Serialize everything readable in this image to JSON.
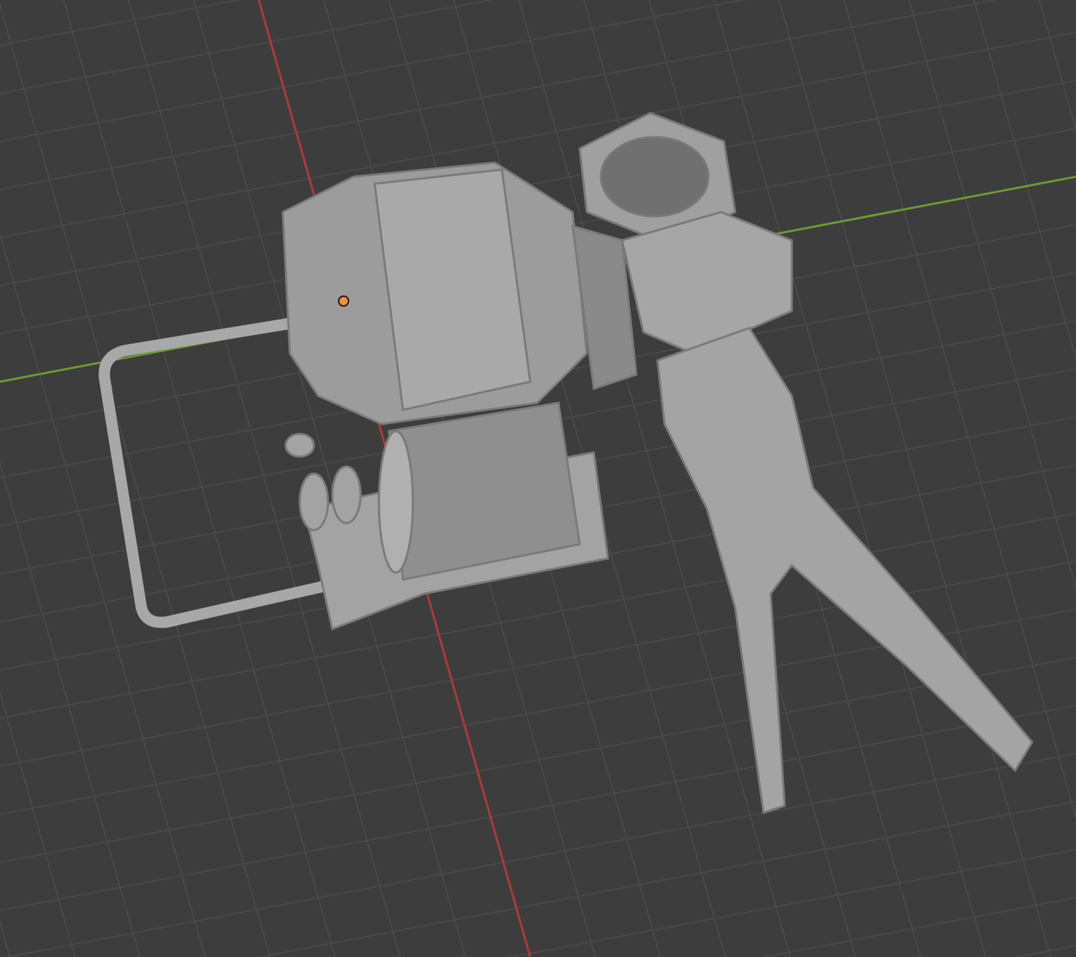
{
  "viewport": {
    "grid": true,
    "object_origin": {
      "selected": true
    }
  }
}
